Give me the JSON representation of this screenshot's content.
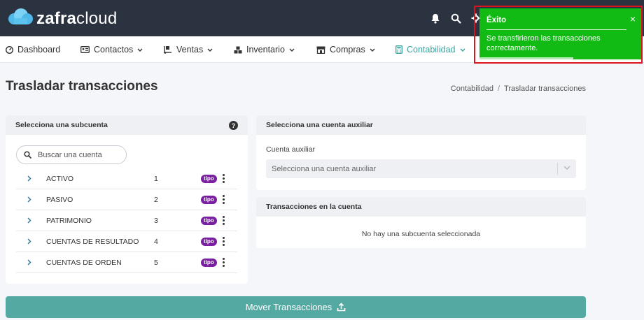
{
  "brand": {
    "logo_bold": "zafra",
    "logo_light": "cloud"
  },
  "nav": {
    "items": [
      {
        "label": "Dashboard"
      },
      {
        "label": "Contactos"
      },
      {
        "label": "Ventas"
      },
      {
        "label": "Inventario"
      },
      {
        "label": "Compras"
      },
      {
        "label": "Contabilidad"
      }
    ],
    "active_color": "#3aa49c"
  },
  "page": {
    "title": "Trasladar transacciones",
    "breadcrumb": {
      "parent": "Contabilidad",
      "separator": "/",
      "current": "Trasladar transacciones"
    }
  },
  "subaccount_panel": {
    "header": "Selecciona una subcuenta",
    "help": "?",
    "search_placeholder": "Buscar una cuenta",
    "badge_label": "tipo",
    "accounts": [
      {
        "name": "ACTIVO",
        "code": "1"
      },
      {
        "name": "PASIVO",
        "code": "2"
      },
      {
        "name": "PATRIMONIO",
        "code": "3"
      },
      {
        "name": "CUENTAS DE RESULTADO",
        "code": "4"
      },
      {
        "name": "CUENTAS DE ORDEN",
        "code": "5"
      }
    ]
  },
  "aux_panel": {
    "header": "Selecciona una cuenta auxiliar",
    "field_label": "Cuenta auxiliar",
    "select_placeholder": "Selecciona una cuenta auxiliar"
  },
  "transactions_panel": {
    "header": "Transacciones en la cuenta",
    "empty_message": "No hay una subcuenta seleccionada"
  },
  "actions": {
    "move_label": "Mover Transacciones"
  },
  "toast": {
    "title": "Éxito",
    "message": "Se transfirieron las transacciones correctamente.",
    "close": "×",
    "progress": 0.58,
    "color": "#12bb14"
  },
  "colors": {
    "topbar": "#2b3340",
    "primary_button": "#55a9a3",
    "badge": "#7b1fa2"
  }
}
